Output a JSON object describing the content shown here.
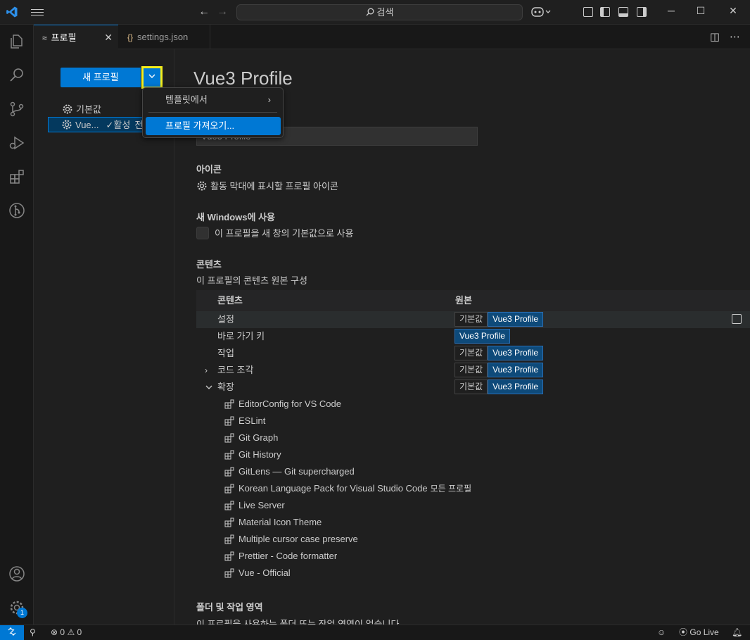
{
  "titlebar": {
    "search_text": "검색",
    "back_icon": "arrow-left-icon",
    "forward_icon": "arrow-right-icon"
  },
  "tabs": [
    {
      "label": "프로필",
      "active": true
    },
    {
      "label": "settings.json",
      "active": false
    }
  ],
  "left": {
    "new_profile_label": "새 프로필",
    "profiles": [
      {
        "name": "기본값"
      },
      {
        "name": "Vue...",
        "active_tag": "✓활성",
        "trailing": "전"
      }
    ]
  },
  "menu": {
    "items": [
      {
        "label": "템플릿에서",
        "has_submenu": true
      },
      {
        "label": "프로필 가져오기...",
        "highlighted": true
      }
    ]
  },
  "main": {
    "title": "Vue3 Profile",
    "name_value": "Vue3 Profile",
    "icon_heading": "아이콘",
    "icon_text": "활동 막대에 표시할 프로필 아이콘",
    "new_windows_heading": "새 Windows에 사용",
    "new_windows_text": "이 프로필을 새 창의 기본값으로 사용",
    "contents_heading": "콘텐츠",
    "contents_text": "이 프로필의 콘텐츠 원본 구성",
    "table_headers": {
      "contents": "콘텐츠",
      "source": "원본"
    },
    "rows": [
      {
        "name": "설정",
        "default_label": "기본값",
        "profile_label": "Vue3 Profile"
      },
      {
        "name": "바로 가기 키",
        "profile_label": "Vue3 Profile"
      },
      {
        "name": "작업",
        "default_label": "기본값",
        "profile_label": "Vue3 Profile"
      },
      {
        "name": "코드 조각",
        "default_label": "기본값",
        "profile_label": "Vue3 Profile"
      },
      {
        "name": "확장",
        "default_label": "기본값",
        "profile_label": "Vue3 Profile"
      }
    ],
    "extensions": [
      "EditorConfig for VS Code",
      "ESLint",
      "Git Graph",
      "Git History",
      "GitLens — Git supercharged",
      "Korean Language Pack for Visual Studio Code",
      "Live Server",
      "Material Icon Theme",
      "Multiple cursor case preserve",
      "Prettier - Code formatter",
      "Vue - Official"
    ],
    "all_profiles_label": "모든 프로필",
    "folders_heading": "폴더 및 작업 영역",
    "folders_text": "이 프로필을 사용하는 폴더 또는 작업 영역이 없습니다"
  },
  "statusbar": {
    "errors": "0",
    "warnings": "0",
    "go_live": "Go Live"
  },
  "activity": {
    "badge": "1"
  },
  "colors": {
    "accent": "#0078d4",
    "highlight_border": "#f5ee1b"
  }
}
